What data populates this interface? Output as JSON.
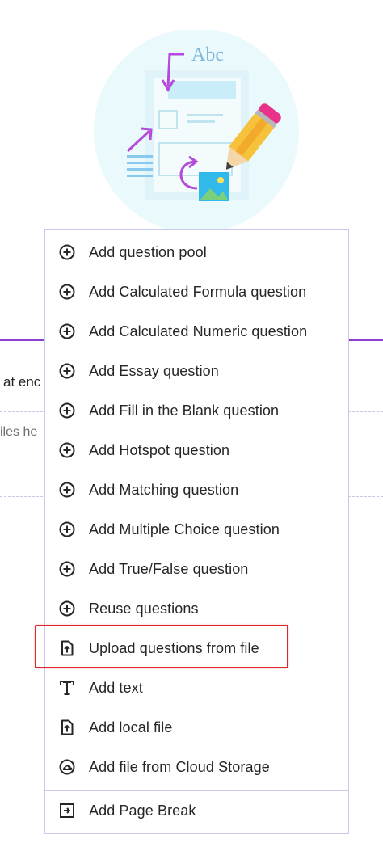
{
  "illustration": {
    "caption_text": "Abc"
  },
  "background": {
    "text_truncated_1": "at enc",
    "text_truncated_2": "iles he"
  },
  "menu": {
    "items": [
      {
        "label": "Add question pool",
        "icon": "plus-circle-icon"
      },
      {
        "label": "Add Calculated Formula question",
        "icon": "plus-circle-icon"
      },
      {
        "label": "Add Calculated Numeric question",
        "icon": "plus-circle-icon"
      },
      {
        "label": "Add Essay question",
        "icon": "plus-circle-icon"
      },
      {
        "label": "Add Fill in the Blank question",
        "icon": "plus-circle-icon"
      },
      {
        "label": "Add Hotspot question",
        "icon": "plus-circle-icon"
      },
      {
        "label": "Add Matching question",
        "icon": "plus-circle-icon"
      },
      {
        "label": "Add Multiple Choice question",
        "icon": "plus-circle-icon"
      },
      {
        "label": "Add True/False question",
        "icon": "plus-circle-icon"
      },
      {
        "label": "Reuse questions",
        "icon": "plus-circle-icon"
      },
      {
        "label": "Upload questions from file",
        "icon": "file-upload-icon"
      },
      {
        "label": "Add text",
        "icon": "text-format-icon"
      },
      {
        "label": "Add local file",
        "icon": "file-upload-icon"
      },
      {
        "label": "Add file from Cloud Storage",
        "icon": "cloud-upload-icon"
      },
      {
        "label": "Add Page Break",
        "icon": "page-break-icon"
      }
    ],
    "highlighted_item": "Upload questions from file",
    "highlight_color": "#e0262b"
  },
  "colors": {
    "accent_purple": "#8b3fd1",
    "menu_border": "#c9c9ee",
    "text": "#262626"
  }
}
